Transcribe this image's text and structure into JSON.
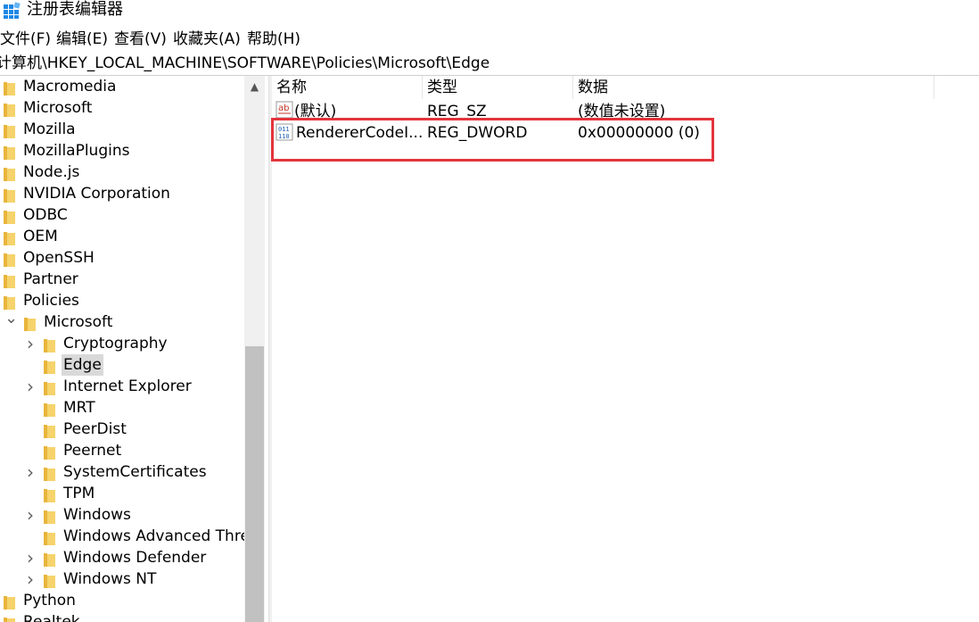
{
  "window": {
    "title": "注册表编辑器"
  },
  "menu": [
    "文件(F)",
    "编辑(E)",
    "查看(V)",
    "收藏夹(A)",
    "帮助(H)"
  ],
  "address": "计算机\\HKEY_LOCAL_MACHINE\\SOFTWARE\\Policies\\Microsoft\\Edge",
  "tree": {
    "top_items": [
      "Macromedia",
      "Microsoft",
      "Mozilla",
      "MozillaPlugins",
      "Node.js",
      "NVIDIA Corporation",
      "ODBC",
      "OEM",
      "OpenSSH",
      "Partner",
      "Policies"
    ],
    "expanded": "Microsoft",
    "children": [
      {
        "label": "Cryptography",
        "expandable": true
      },
      {
        "label": "Edge",
        "expandable": false,
        "selected": true
      },
      {
        "label": "Internet Explorer",
        "expandable": true
      },
      {
        "label": "MRT",
        "expandable": false
      },
      {
        "label": "PeerDist",
        "expandable": false
      },
      {
        "label": "Peernet",
        "expandable": false
      },
      {
        "label": "SystemCertificates",
        "expandable": true
      },
      {
        "label": "TPM",
        "expandable": false
      },
      {
        "label": "Windows",
        "expandable": true
      },
      {
        "label": "Windows Advanced Thre",
        "expandable": false
      },
      {
        "label": "Windows Defender",
        "expandable": true
      },
      {
        "label": "Windows NT",
        "expandable": true
      }
    ],
    "bottom_items": [
      "Python",
      "Realtek"
    ]
  },
  "list": {
    "columns": [
      "名称",
      "类型",
      "数据"
    ],
    "rows": [
      {
        "name": "(默认)",
        "type": "REG_SZ",
        "data": "(数值未设置)",
        "icon": "string-value-icon"
      },
      {
        "name": "RendererCodeI...",
        "type": "REG_DWORD",
        "data": "0x00000000 (0)",
        "icon": "binary-value-icon"
      }
    ]
  },
  "colors": {
    "highlight": "#e3343c",
    "folder": "#f2c94c",
    "selection": "#d9d9d9"
  }
}
